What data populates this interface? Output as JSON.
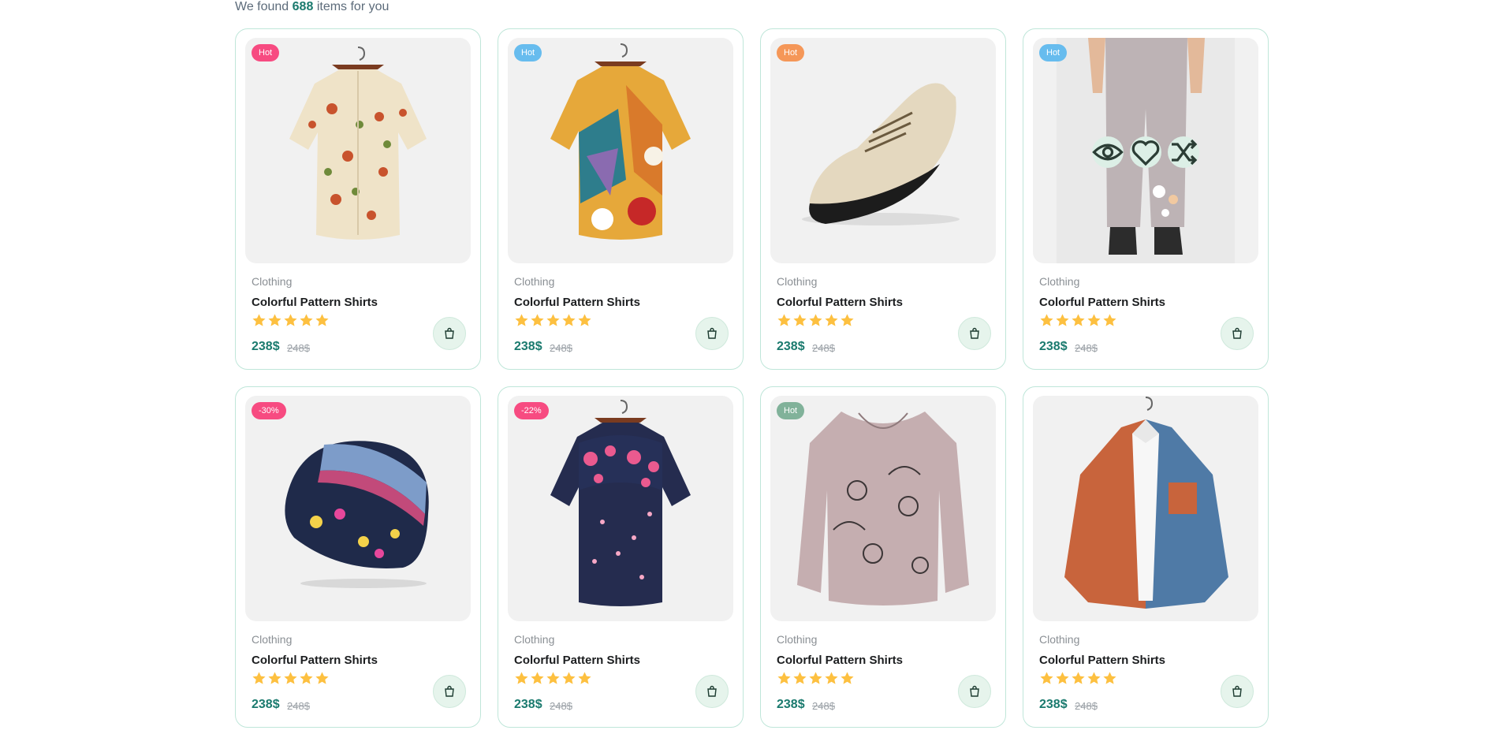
{
  "summary": {
    "prefix": "We found",
    "count": "688",
    "suffix": "items for you"
  },
  "colors": {
    "accent": "#1a7a6e",
    "star": "#fdc040",
    "card_border": "#bfe6d9"
  },
  "products": [
    {
      "badge": "Hot",
      "badge_color": "#f74b81",
      "category": "Clothing",
      "title": "Colorful Pattern Shirts",
      "rating": 5,
      "price": "238$",
      "old_price": "248$",
      "image": "mushroom-print-shirt"
    },
    {
      "badge": "Hot",
      "badge_color": "#67bcee",
      "category": "Clothing",
      "title": "Colorful Pattern Shirts",
      "rating": 5,
      "price": "238$",
      "old_price": "248$",
      "image": "abstract-print-shirt"
    },
    {
      "badge": "Hot",
      "badge_color": "#f59758",
      "category": "Clothing",
      "title": "Colorful Pattern Shirts",
      "rating": 5,
      "price": "238$",
      "old_price": "248$",
      "image": "beige-sneaker"
    },
    {
      "badge": "Hot",
      "badge_color": "#67bcee",
      "category": "Clothing",
      "title": "Colorful Pattern Shirts",
      "rating": 5,
      "price": "238$",
      "old_price": "248$",
      "image": "floral-linen-pants"
    },
    {
      "badge": "-30%",
      "badge_color": "#f74b81",
      "category": "Clothing",
      "title": "Colorful Pattern Shirts",
      "rating": 5,
      "price": "238$",
      "old_price": "248$",
      "image": "floral-beanie"
    },
    {
      "badge": "-22%",
      "badge_color": "#f74b81",
      "category": "Clothing",
      "title": "Colorful Pattern Shirts",
      "rating": 5,
      "price": "238$",
      "old_price": "248$",
      "image": "navy-floral-shirt"
    },
    {
      "badge": "Hot",
      "badge_color": "#81b29a",
      "category": "Clothing",
      "title": "Colorful Pattern Shirts",
      "rating": 5,
      "price": "238$",
      "old_price": "248$",
      "image": "cat-print-blouse"
    },
    {
      "badge": "",
      "badge_color": "",
      "category": "Clothing",
      "title": "Colorful Pattern Shirts",
      "rating": 5,
      "price": "238$",
      "old_price": "248$",
      "image": "colorblock-shirt"
    }
  ],
  "hover_actions": [
    "eye-icon",
    "heart-icon",
    "shuffle-icon"
  ],
  "cart_icon": "shopping-bag-icon"
}
